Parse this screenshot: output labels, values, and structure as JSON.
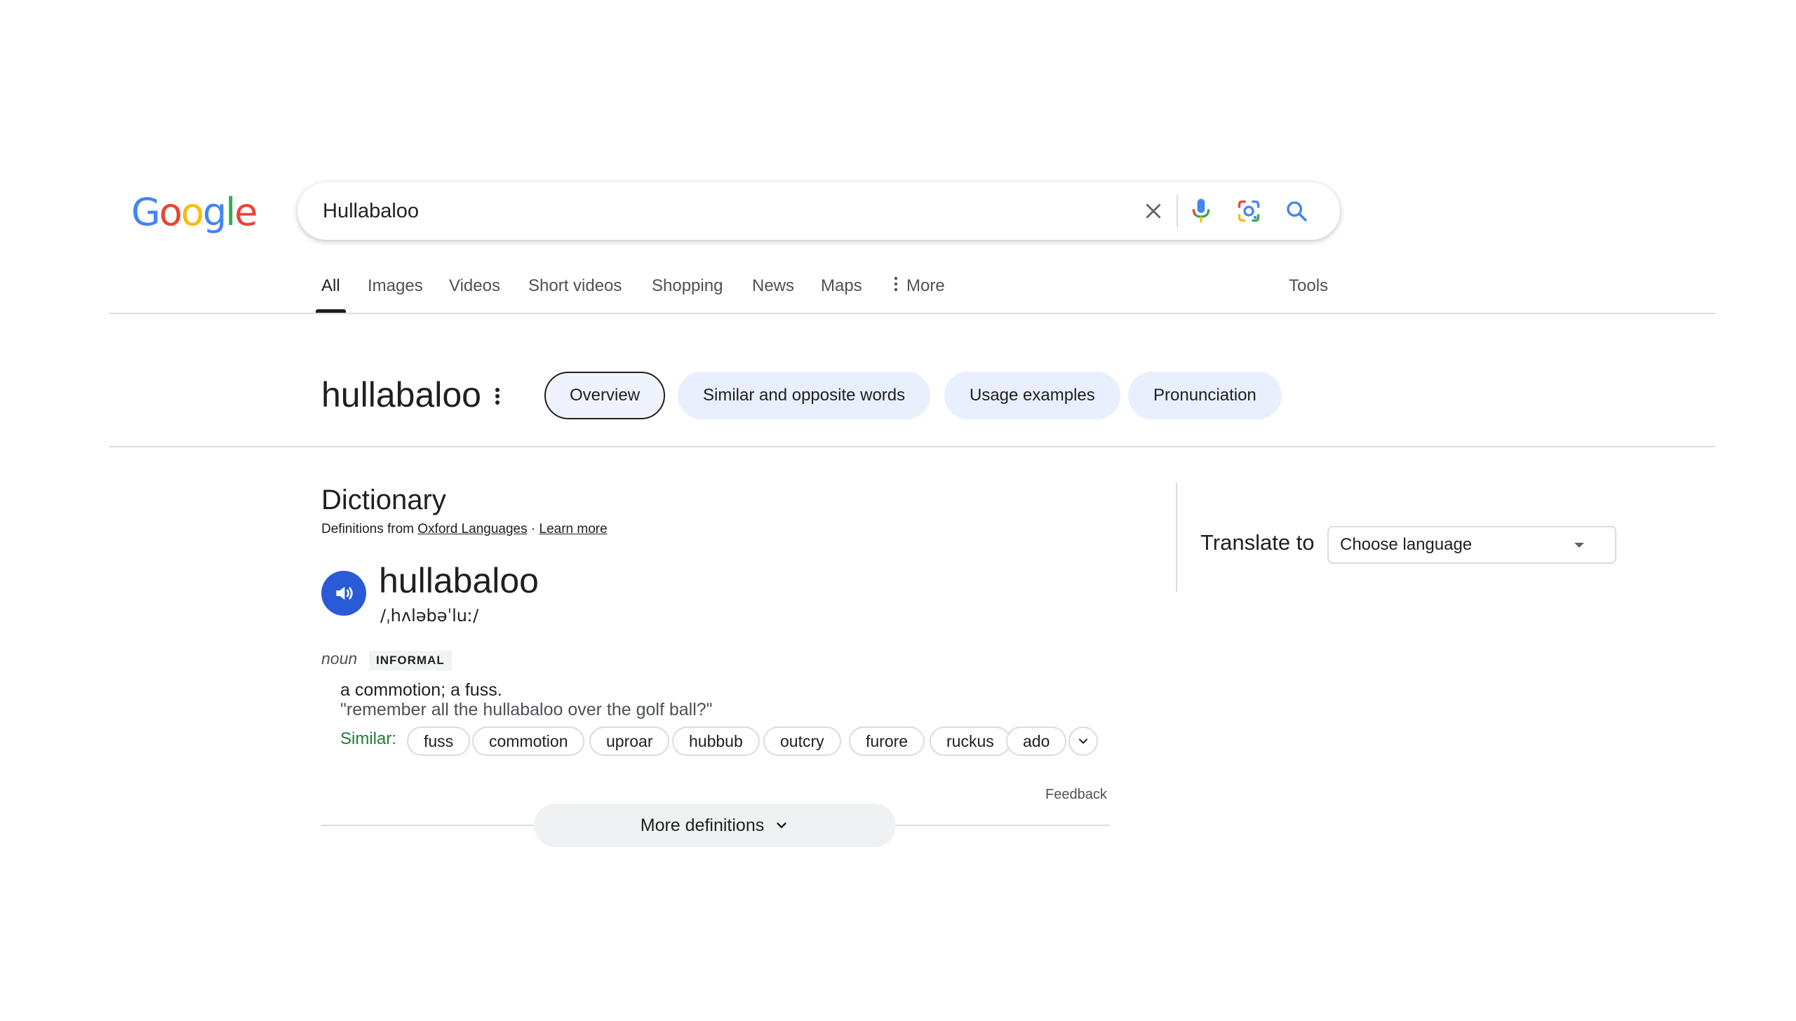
{
  "logo": {
    "letters": [
      "G",
      "o",
      "o",
      "g",
      "l",
      "e"
    ],
    "colors": [
      "#4285F4",
      "#EA4335",
      "#FBBC05",
      "#4285F4",
      "#34A853",
      "#EA4335"
    ]
  },
  "search": {
    "query": "Hullabaloo",
    "clear_icon": "close-icon",
    "voice_icon": "microphone-icon",
    "lens_icon": "camera-lens-icon",
    "search_icon": "search-icon"
  },
  "tabs": {
    "items": [
      "All",
      "Images",
      "Videos",
      "Short videos",
      "Shopping",
      "News",
      "Maps"
    ],
    "more": "More",
    "tools": "Tools",
    "active": "All"
  },
  "word": {
    "title": "hullabaloo",
    "pills": [
      "Overview",
      "Similar and opposite words",
      "Usage examples",
      "Pronunciation"
    ],
    "active_pill": "Overview"
  },
  "dictionary": {
    "heading": "Dictionary",
    "source_prefix": "Definitions from",
    "source_link": "Oxford Languages",
    "separator": "·",
    "learn_more": "Learn more",
    "headword": "hullabaloo",
    "phonetic": "/ˌhʌləbəˈluː/",
    "part_of_speech": "noun",
    "register": "INFORMAL",
    "definition": "a commotion; a fuss.",
    "example": "\"remember all the hullabaloo over the golf ball?\"",
    "similar_label": "Similar:",
    "similar": [
      "fuss",
      "commotion",
      "uproar",
      "hubbub",
      "outcry",
      "furore",
      "ruckus",
      "ado"
    ],
    "feedback": "Feedback",
    "more_definitions": "More definitions"
  },
  "translate": {
    "label": "Translate to",
    "select_value": "Choose language"
  },
  "colors": {
    "accent_blue": "#2a5bd7",
    "similar_green": "#1e7e34",
    "pill_bg": "#e8effd"
  }
}
